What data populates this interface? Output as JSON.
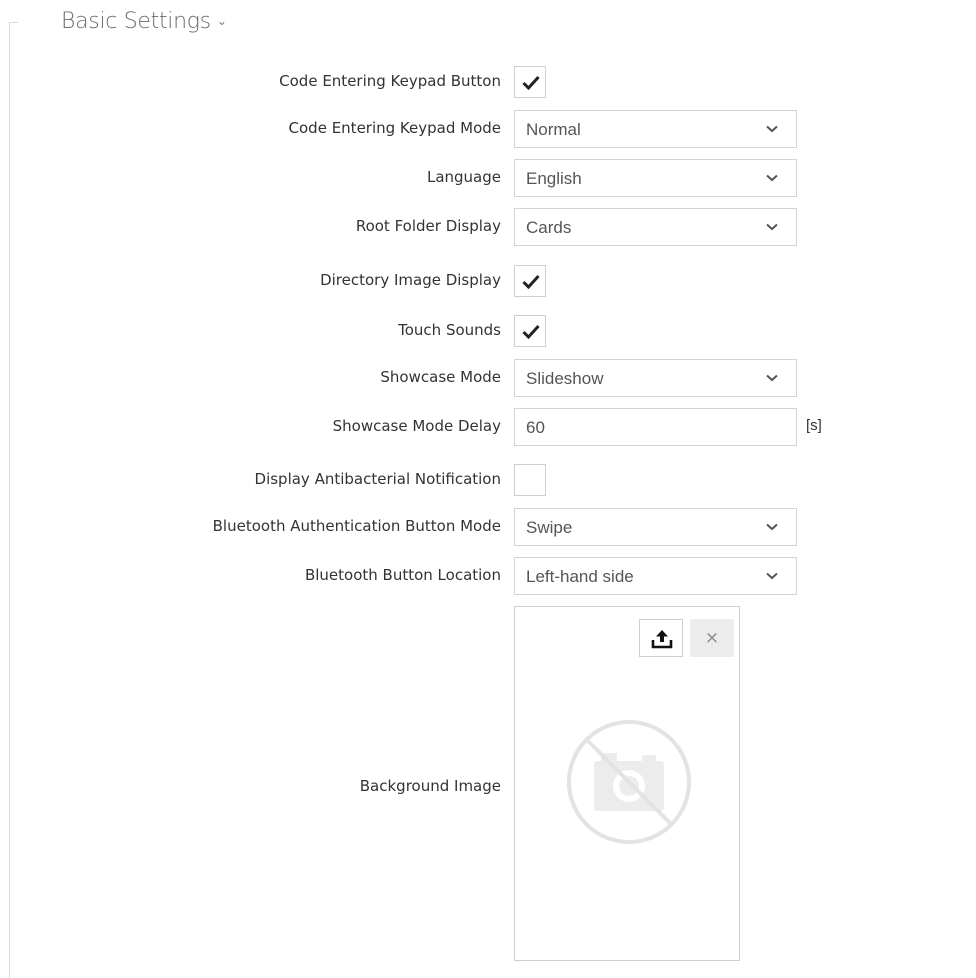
{
  "section": {
    "title": "Basic Settings",
    "chevron": "›"
  },
  "fields": {
    "code_entering_keypad_button": {
      "label": "Code Entering Keypad Button",
      "checked": true
    },
    "code_entering_keypad_mode": {
      "label": "Code Entering Keypad Mode",
      "value": "Normal"
    },
    "language": {
      "label": "Language",
      "value": "English"
    },
    "root_folder_display": {
      "label": "Root Folder Display",
      "value": "Cards"
    },
    "directory_image_display": {
      "label": "Directory Image Display",
      "checked": true
    },
    "touch_sounds": {
      "label": "Touch Sounds",
      "checked": true
    },
    "showcase_mode": {
      "label": "Showcase Mode",
      "value": "Slideshow"
    },
    "showcase_mode_delay": {
      "label": "Showcase Mode Delay",
      "value": "60",
      "unit": "[s]"
    },
    "display_antibacterial_notification": {
      "label": "Display Antibacterial Notification",
      "checked": false
    },
    "bluetooth_authentication_button_mode": {
      "label": "Bluetooth Authentication Button Mode",
      "value": "Swipe"
    },
    "bluetooth_button_location": {
      "label": "Bluetooth Button Location",
      "value": "Left-hand side"
    },
    "background_image": {
      "label": "Background Image",
      "upload_icon": "upload-icon",
      "clear_label": "×",
      "placeholder_icon": "no-photo-icon"
    }
  },
  "colors": {
    "text": "#333333",
    "border": "#d3d3d3",
    "title": "#6a6a6a",
    "clear_bg": "#ececec"
  }
}
